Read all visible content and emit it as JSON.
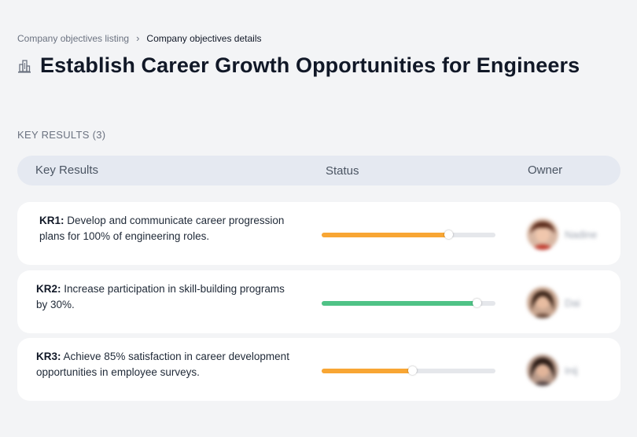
{
  "breadcrumb": {
    "parent": "Company objectives listing",
    "separator": "›",
    "current": "Company objectives details"
  },
  "page": {
    "icon": "building-icon",
    "title": "Establish Career Growth Opportunities for Engineers"
  },
  "section": {
    "label": "KEY RESULTS (3)"
  },
  "table": {
    "headers": {
      "key_results": "Key Results",
      "status": "Status",
      "owner": "Owner"
    }
  },
  "colors": {
    "orange": "#f8a634",
    "green": "#4fc286",
    "track": "#e5e7eb"
  },
  "key_results": [
    {
      "id": "KR1:",
      "text": "Develop and communicate career progression plans for 100% of engineering roles.",
      "progress": 0.73,
      "color": "#f8a634",
      "owner": {
        "name": "Nadine",
        "avatar": "avatar-icon"
      }
    },
    {
      "id": "KR2:",
      "text": "Increase participation in skill-building programs by 30%.",
      "progress": 0.89,
      "color": "#4fc286",
      "owner": {
        "name": "Dai",
        "avatar": "avatar-icon"
      }
    },
    {
      "id": "KR3:",
      "text": "Achieve 85% satisfaction in career development opportunities in employee surveys.",
      "progress": 0.52,
      "color": "#f8a634",
      "owner": {
        "name": "Inij",
        "avatar": "avatar-icon"
      }
    }
  ]
}
